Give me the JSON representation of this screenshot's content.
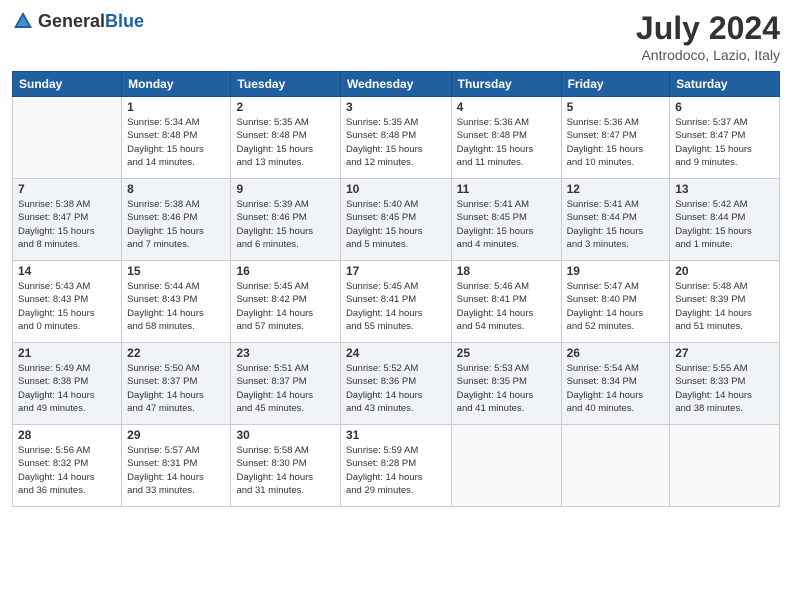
{
  "logo": {
    "text_general": "General",
    "text_blue": "Blue"
  },
  "title": "July 2024",
  "subtitle": "Antrodoco, Lazio, Italy",
  "days_of_week": [
    "Sunday",
    "Monday",
    "Tuesday",
    "Wednesday",
    "Thursday",
    "Friday",
    "Saturday"
  ],
  "weeks": [
    [
      {
        "num": "",
        "info": ""
      },
      {
        "num": "1",
        "info": "Sunrise: 5:34 AM\nSunset: 8:48 PM\nDaylight: 15 hours\nand 14 minutes."
      },
      {
        "num": "2",
        "info": "Sunrise: 5:35 AM\nSunset: 8:48 PM\nDaylight: 15 hours\nand 13 minutes."
      },
      {
        "num": "3",
        "info": "Sunrise: 5:35 AM\nSunset: 8:48 PM\nDaylight: 15 hours\nand 12 minutes."
      },
      {
        "num": "4",
        "info": "Sunrise: 5:36 AM\nSunset: 8:48 PM\nDaylight: 15 hours\nand 11 minutes."
      },
      {
        "num": "5",
        "info": "Sunrise: 5:36 AM\nSunset: 8:47 PM\nDaylight: 15 hours\nand 10 minutes."
      },
      {
        "num": "6",
        "info": "Sunrise: 5:37 AM\nSunset: 8:47 PM\nDaylight: 15 hours\nand 9 minutes."
      }
    ],
    [
      {
        "num": "7",
        "info": "Sunrise: 5:38 AM\nSunset: 8:47 PM\nDaylight: 15 hours\nand 8 minutes."
      },
      {
        "num": "8",
        "info": "Sunrise: 5:38 AM\nSunset: 8:46 PM\nDaylight: 15 hours\nand 7 minutes."
      },
      {
        "num": "9",
        "info": "Sunrise: 5:39 AM\nSunset: 8:46 PM\nDaylight: 15 hours\nand 6 minutes."
      },
      {
        "num": "10",
        "info": "Sunrise: 5:40 AM\nSunset: 8:45 PM\nDaylight: 15 hours\nand 5 minutes."
      },
      {
        "num": "11",
        "info": "Sunrise: 5:41 AM\nSunset: 8:45 PM\nDaylight: 15 hours\nand 4 minutes."
      },
      {
        "num": "12",
        "info": "Sunrise: 5:41 AM\nSunset: 8:44 PM\nDaylight: 15 hours\nand 3 minutes."
      },
      {
        "num": "13",
        "info": "Sunrise: 5:42 AM\nSunset: 8:44 PM\nDaylight: 15 hours\nand 1 minute."
      }
    ],
    [
      {
        "num": "14",
        "info": "Sunrise: 5:43 AM\nSunset: 8:43 PM\nDaylight: 15 hours\nand 0 minutes."
      },
      {
        "num": "15",
        "info": "Sunrise: 5:44 AM\nSunset: 8:43 PM\nDaylight: 14 hours\nand 58 minutes."
      },
      {
        "num": "16",
        "info": "Sunrise: 5:45 AM\nSunset: 8:42 PM\nDaylight: 14 hours\nand 57 minutes."
      },
      {
        "num": "17",
        "info": "Sunrise: 5:45 AM\nSunset: 8:41 PM\nDaylight: 14 hours\nand 55 minutes."
      },
      {
        "num": "18",
        "info": "Sunrise: 5:46 AM\nSunset: 8:41 PM\nDaylight: 14 hours\nand 54 minutes."
      },
      {
        "num": "19",
        "info": "Sunrise: 5:47 AM\nSunset: 8:40 PM\nDaylight: 14 hours\nand 52 minutes."
      },
      {
        "num": "20",
        "info": "Sunrise: 5:48 AM\nSunset: 8:39 PM\nDaylight: 14 hours\nand 51 minutes."
      }
    ],
    [
      {
        "num": "21",
        "info": "Sunrise: 5:49 AM\nSunset: 8:38 PM\nDaylight: 14 hours\nand 49 minutes."
      },
      {
        "num": "22",
        "info": "Sunrise: 5:50 AM\nSunset: 8:37 PM\nDaylight: 14 hours\nand 47 minutes."
      },
      {
        "num": "23",
        "info": "Sunrise: 5:51 AM\nSunset: 8:37 PM\nDaylight: 14 hours\nand 45 minutes."
      },
      {
        "num": "24",
        "info": "Sunrise: 5:52 AM\nSunset: 8:36 PM\nDaylight: 14 hours\nand 43 minutes."
      },
      {
        "num": "25",
        "info": "Sunrise: 5:53 AM\nSunset: 8:35 PM\nDaylight: 14 hours\nand 41 minutes."
      },
      {
        "num": "26",
        "info": "Sunrise: 5:54 AM\nSunset: 8:34 PM\nDaylight: 14 hours\nand 40 minutes."
      },
      {
        "num": "27",
        "info": "Sunrise: 5:55 AM\nSunset: 8:33 PM\nDaylight: 14 hours\nand 38 minutes."
      }
    ],
    [
      {
        "num": "28",
        "info": "Sunrise: 5:56 AM\nSunset: 8:32 PM\nDaylight: 14 hours\nand 36 minutes."
      },
      {
        "num": "29",
        "info": "Sunrise: 5:57 AM\nSunset: 8:31 PM\nDaylight: 14 hours\nand 33 minutes."
      },
      {
        "num": "30",
        "info": "Sunrise: 5:58 AM\nSunset: 8:30 PM\nDaylight: 14 hours\nand 31 minutes."
      },
      {
        "num": "31",
        "info": "Sunrise: 5:59 AM\nSunset: 8:28 PM\nDaylight: 14 hours\nand 29 minutes."
      },
      {
        "num": "",
        "info": ""
      },
      {
        "num": "",
        "info": ""
      },
      {
        "num": "",
        "info": ""
      }
    ]
  ]
}
